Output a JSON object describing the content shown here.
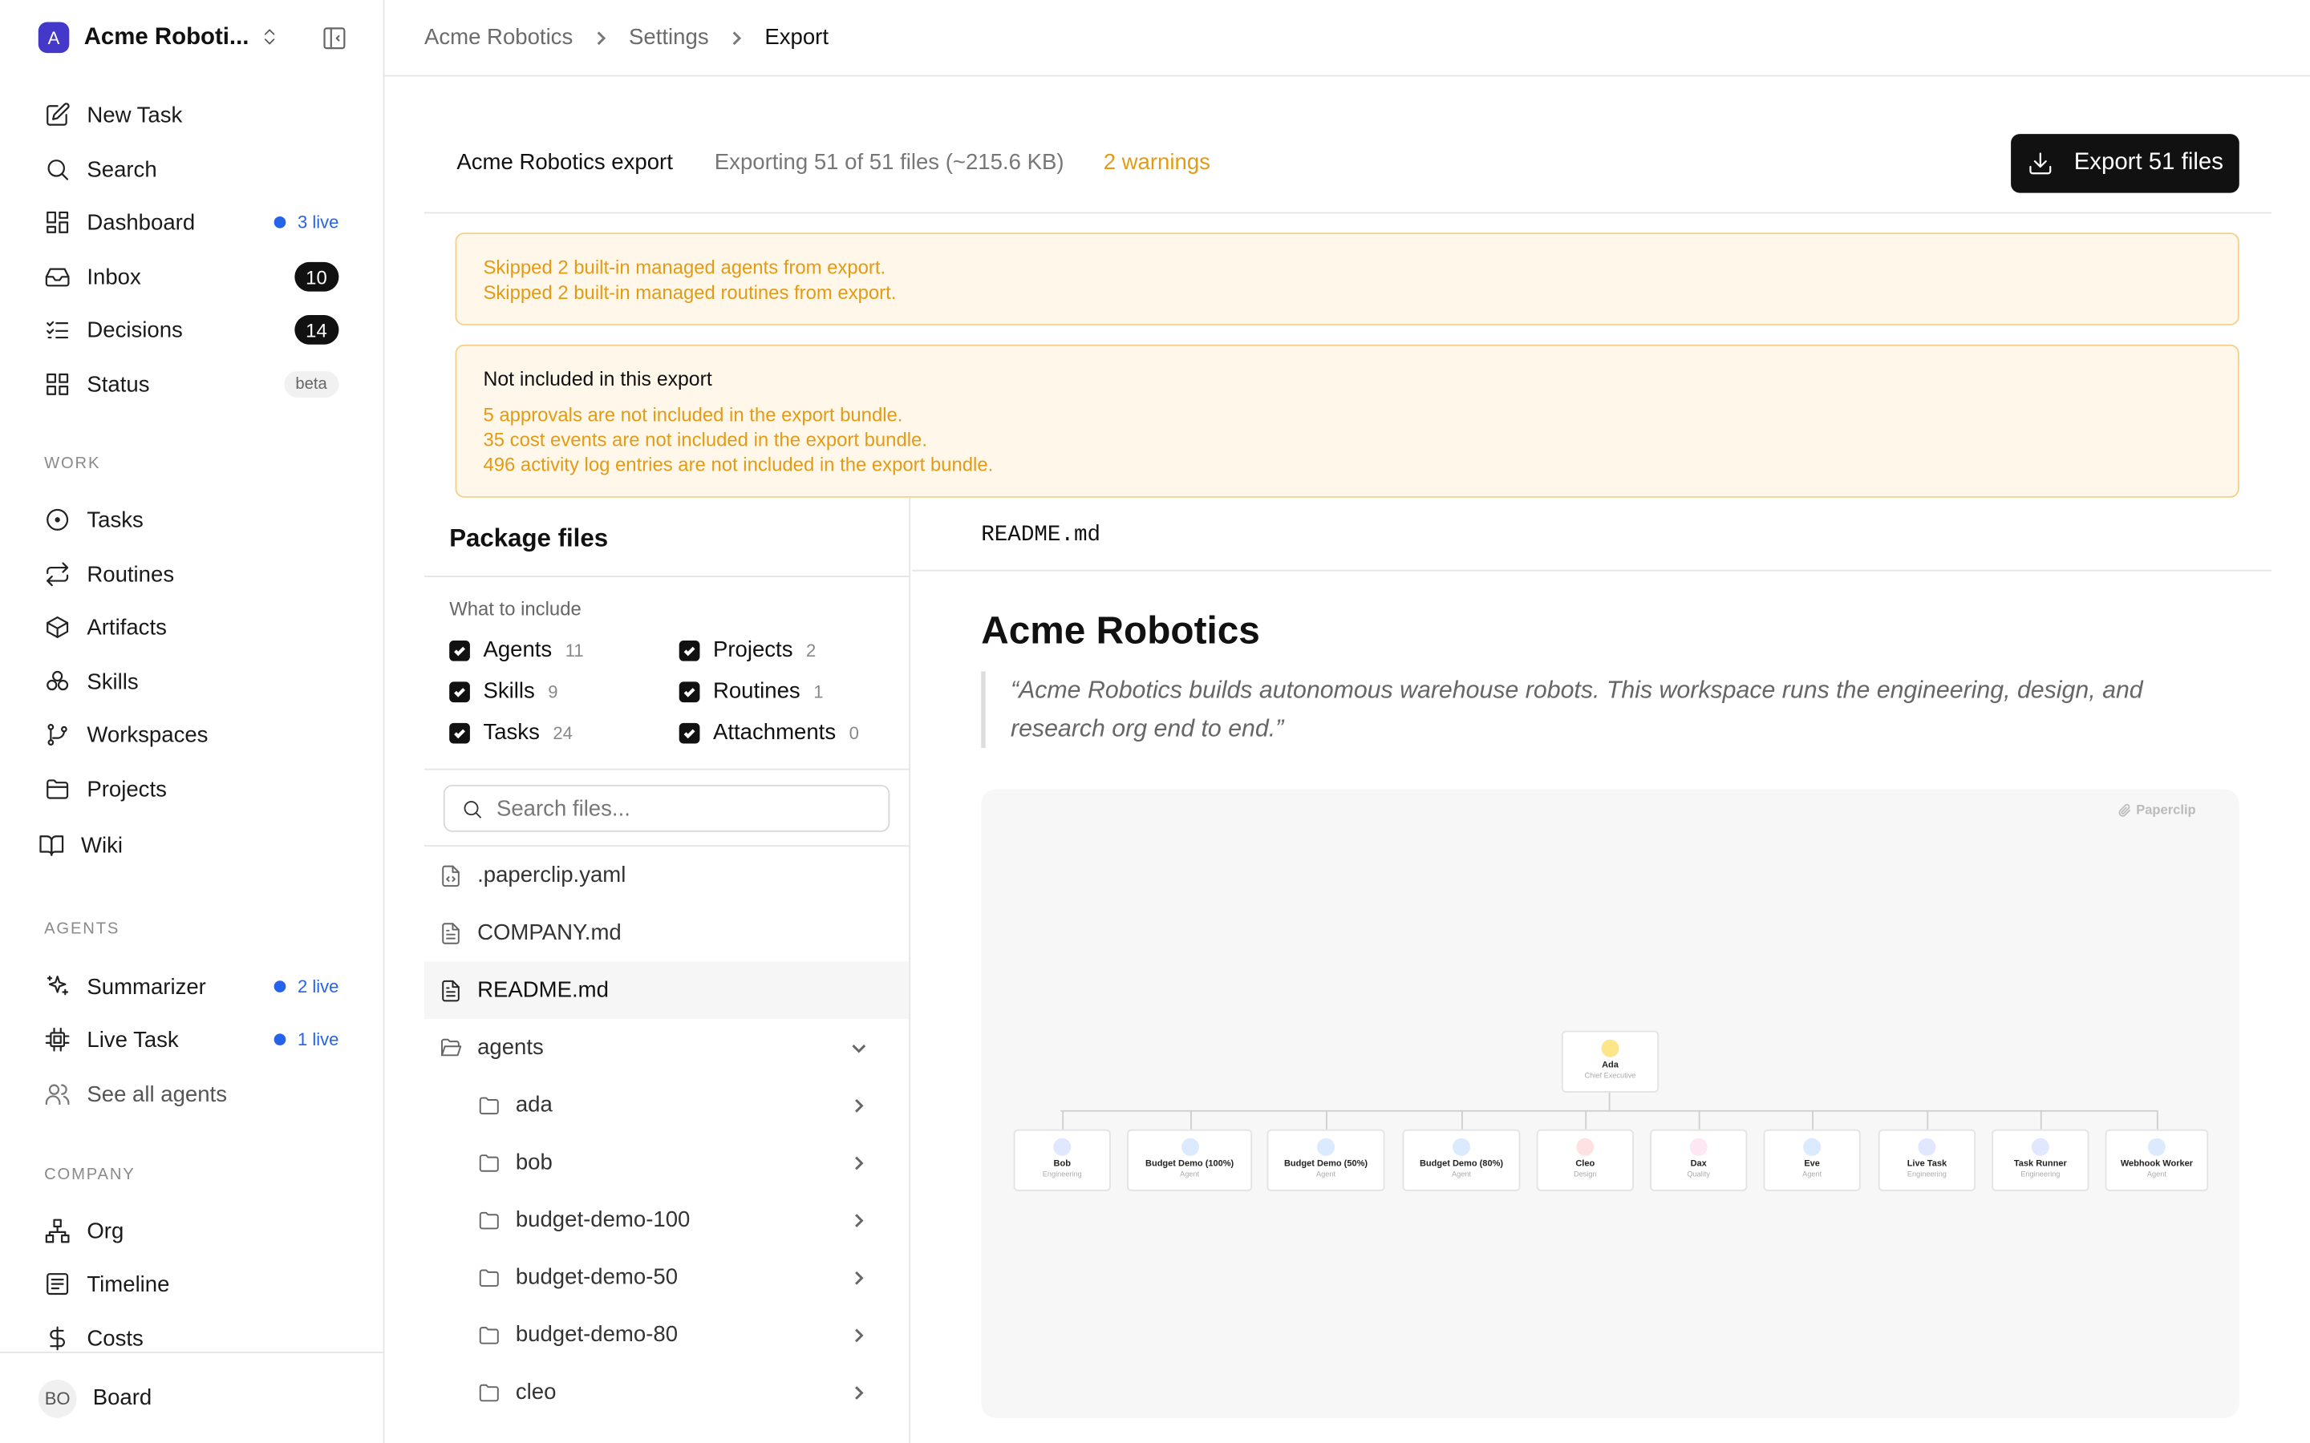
{
  "workspace": {
    "name": "Acme Roboti...",
    "logo_letter": "A"
  },
  "nav": {
    "new_task": "New Task",
    "search": "Search",
    "dashboard": {
      "label": "Dashboard",
      "live": "3 live"
    },
    "inbox": {
      "label": "Inbox",
      "badge": "10"
    },
    "decisions": {
      "label": "Decisions",
      "badge": "14"
    },
    "status": {
      "label": "Status",
      "badge": "beta"
    }
  },
  "work": {
    "heading": "WORK",
    "items": [
      "Tasks",
      "Routines",
      "Artifacts",
      "Skills",
      "Workspaces",
      "Projects",
      "Wiki"
    ]
  },
  "agents_section": {
    "heading": "AGENTS",
    "summarizer": {
      "label": "Summarizer",
      "live": "2 live"
    },
    "live_task": {
      "label": "Live Task",
      "live": "1 live"
    },
    "see_all": "See all agents"
  },
  "company": {
    "heading": "COMPANY",
    "items": [
      "Org",
      "Timeline",
      "Costs"
    ]
  },
  "user": {
    "initials": "BO",
    "name": "Board"
  },
  "breadcrumb": [
    "Acme Robotics",
    "Settings",
    "Export"
  ],
  "export": {
    "title": "Acme Robotics export",
    "info": "Exporting 51 of 51 files (~215.6 KB)",
    "warnings": "2 warnings",
    "button": "Export 51 files"
  },
  "alerts": {
    "skipped": [
      "Skipped 2 built-in managed agents from export.",
      "Skipped 2 built-in managed routines from export."
    ],
    "not_included_title": "Not included in this export",
    "not_included": [
      "5 approvals are not included in the export bundle.",
      "35 cost events are not included in the export bundle.",
      "496 activity log entries are not included in the export bundle."
    ]
  },
  "package": {
    "title": "Package files",
    "include_label": "What to include",
    "options": [
      {
        "label": "Agents",
        "count": "11",
        "checked": true
      },
      {
        "label": "Projects",
        "count": "2",
        "checked": true
      },
      {
        "label": "Skills",
        "count": "9",
        "checked": true
      },
      {
        "label": "Routines",
        "count": "1",
        "checked": true
      },
      {
        "label": "Tasks",
        "count": "24",
        "checked": true
      },
      {
        "label": "Attachments",
        "count": "0",
        "checked": true
      }
    ],
    "search_placeholder": "Search files...",
    "files": [
      ".paperclip.yaml",
      "COMPANY.md",
      "README.md"
    ],
    "folder": "agents",
    "subfolders": [
      "ada",
      "bob",
      "budget-demo-100",
      "budget-demo-50",
      "budget-demo-80",
      "cleo"
    ]
  },
  "preview": {
    "filename": "README.md",
    "heading": "Acme Robotics",
    "quote": "“Acme Robotics builds autonomous warehouse robots. This workspace runs the engineering, design, and research org end to end.”",
    "watermark": "Paperclip",
    "org_root": {
      "name": "Ada",
      "role": "Chief Executive",
      "color": "#fde68a"
    },
    "org_children": [
      {
        "name": "Bob",
        "role": "Engineering",
        "color": "#e0e7ff"
      },
      {
        "name": "Budget Demo (100%)",
        "role": "Agent",
        "color": "#dbeafe"
      },
      {
        "name": "Budget Demo (50%)",
        "role": "Agent",
        "color": "#dbeafe"
      },
      {
        "name": "Budget Demo (80%)",
        "role": "Agent",
        "color": "#dbeafe"
      },
      {
        "name": "Cleo",
        "role": "Design",
        "color": "#fee2e2"
      },
      {
        "name": "Dax",
        "role": "Quality",
        "color": "#fce7f3"
      },
      {
        "name": "Eve",
        "role": "Agent",
        "color": "#dbeafe"
      },
      {
        "name": "Live Task",
        "role": "Engineering",
        "color": "#e0e7ff"
      },
      {
        "name": "Task Runner",
        "role": "Engineering",
        "color": "#e0e7ff"
      },
      {
        "name": "Webhook Worker",
        "role": "Agent",
        "color": "#dbeafe"
      }
    ]
  },
  "colors": {
    "accent": "#2563eb",
    "warning": "#e39b15",
    "alert_bg": "#fff7ea",
    "primary_button": "#111111"
  }
}
